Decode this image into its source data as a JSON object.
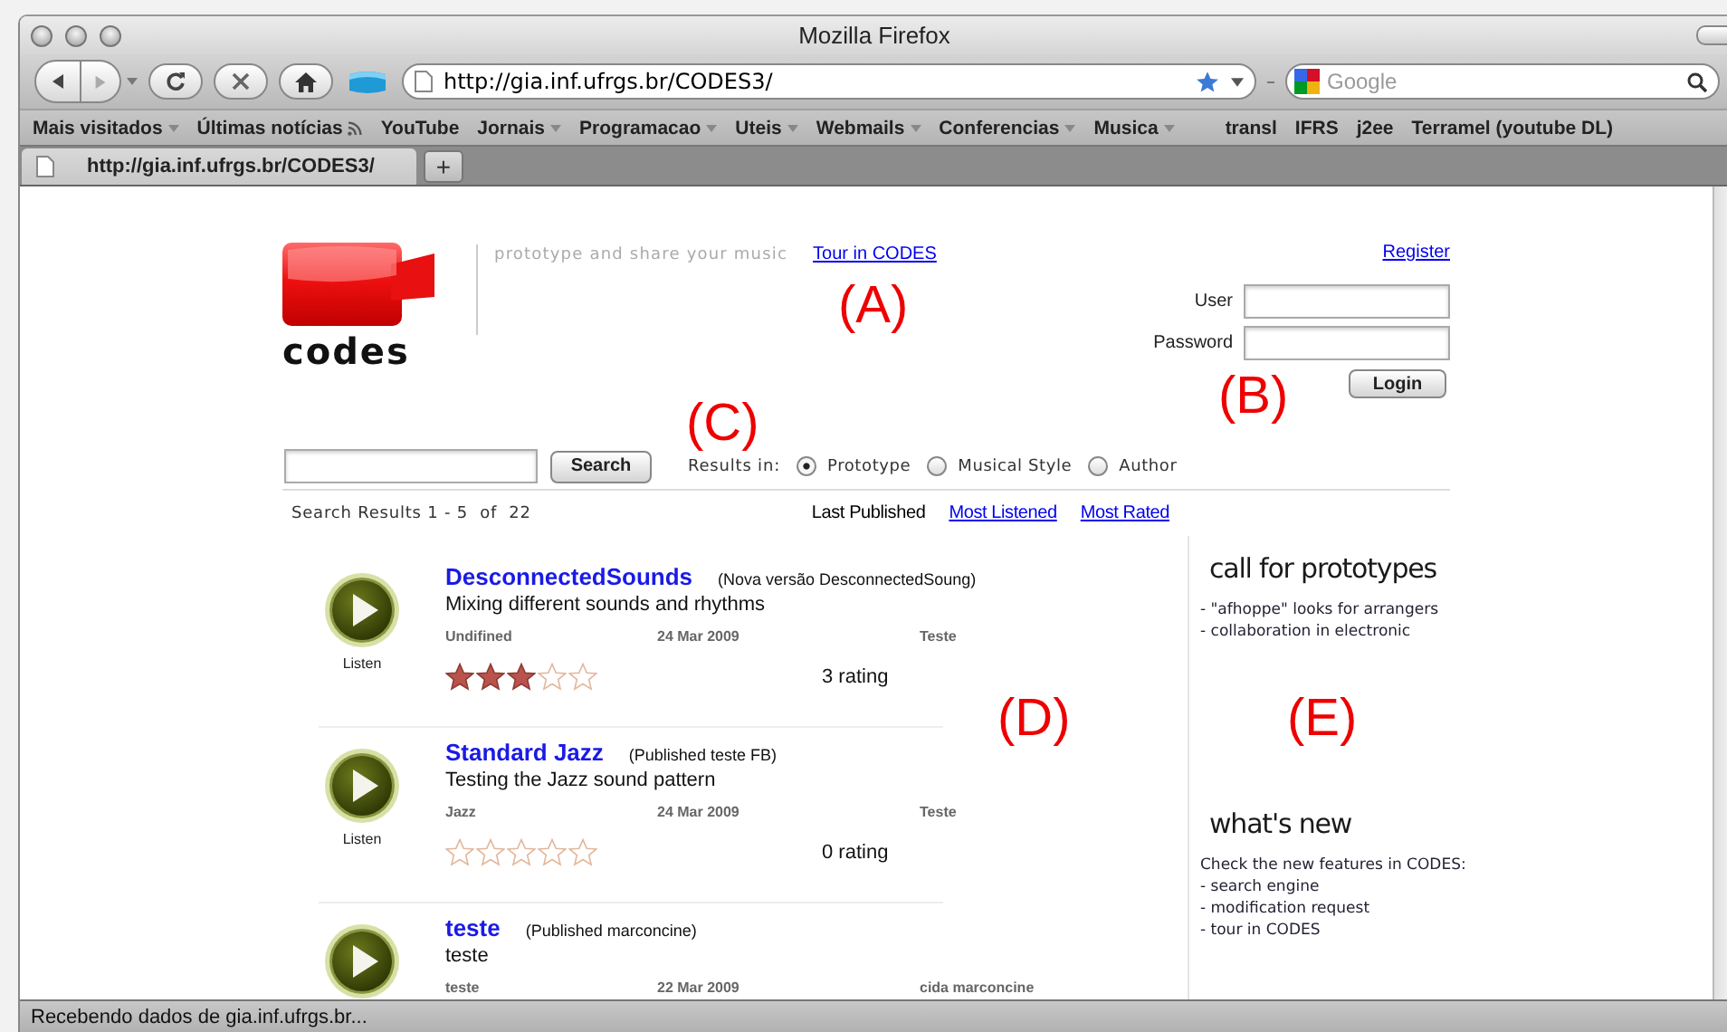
{
  "window": {
    "title": "Mozilla Firefox"
  },
  "toolbar": {
    "url": "http://gia.inf.ufrgs.br/CODES3/",
    "search_placeholder": "Google"
  },
  "bookmarks": [
    {
      "label": "Mais visitados",
      "kind": "folder"
    },
    {
      "label": "Últimas notícias",
      "kind": "feed"
    },
    {
      "label": "YouTube",
      "kind": "link"
    },
    {
      "label": "Jornais",
      "kind": "folder"
    },
    {
      "label": "Programacao",
      "kind": "folder"
    },
    {
      "label": "Uteis",
      "kind": "folder"
    },
    {
      "label": "Webmails",
      "kind": "folder"
    },
    {
      "label": "Conferencias",
      "kind": "folder"
    },
    {
      "label": "Musica",
      "kind": "folder"
    },
    {
      "label": "transl",
      "kind": "link"
    },
    {
      "label": "IFRS",
      "kind": "link"
    },
    {
      "label": "j2ee",
      "kind": "link"
    },
    {
      "label": "Terramel (youtube DL)",
      "kind": "link"
    }
  ],
  "tabs": [
    {
      "label": "http://gia.inf.ufrgs.br/CODES3/",
      "selected": true
    }
  ],
  "new_tab_button": "+",
  "header": {
    "logo": "codes",
    "tagline": "prototype and share your music",
    "tour_link": "Tour in CODES"
  },
  "login": {
    "register_link": "Register",
    "user_label": "User",
    "password_label": "Password",
    "button": "Login"
  },
  "search": {
    "button": "Search",
    "results_in_label": "Results in:",
    "options": [
      {
        "label": "Prototype",
        "selected": true
      },
      {
        "label": "Musical Style",
        "selected": false
      },
      {
        "label": "Author",
        "selected": false
      }
    ]
  },
  "results": {
    "summary": "Search Results 1 - 5  of  22",
    "sort_options": [
      {
        "label": "Last Published",
        "selected": true
      },
      {
        "label": "Most Listened",
        "selected": false
      },
      {
        "label": "Most Rated",
        "selected": false
      }
    ],
    "items": [
      {
        "title": "DesconnectedSounds",
        "note": "(Nova versão DesconnectedSoung)",
        "description": "Mixing different sounds and rhythms",
        "style": "Undifined",
        "date": "24 Mar 2009",
        "author": "Teste",
        "listen_label": "Listen",
        "stars": 3,
        "rating": "3  rating"
      },
      {
        "title": "Standard Jazz",
        "note": "(Published teste FB)",
        "description": "Testing the Jazz sound pattern",
        "style": "Jazz",
        "date": "24 Mar 2009",
        "author": "Teste",
        "listen_label": "Listen",
        "stars": 0,
        "rating": "0  rating"
      },
      {
        "title": "teste",
        "note": "(Published marconcine)",
        "description": "teste",
        "style": "teste",
        "date": "22 Mar 2009",
        "author": "cida marconcine"
      }
    ]
  },
  "sidebar": {
    "sections": [
      {
        "heading": "call for prototypes",
        "lines": [
          "- \"afhoppe\" looks for arrangers",
          "- collaboration in electronic"
        ]
      },
      {
        "heading": "what's new",
        "lines": [
          "Check the new features in CODES:",
          "- search engine",
          "- modification request",
          "- tour in CODES"
        ]
      }
    ]
  },
  "annotations": [
    "(A)",
    "(B)",
    "(C)",
    "(D)",
    "(E)"
  ],
  "status_bar": "Recebendo dados de gia.inf.ufrgs.br..."
}
